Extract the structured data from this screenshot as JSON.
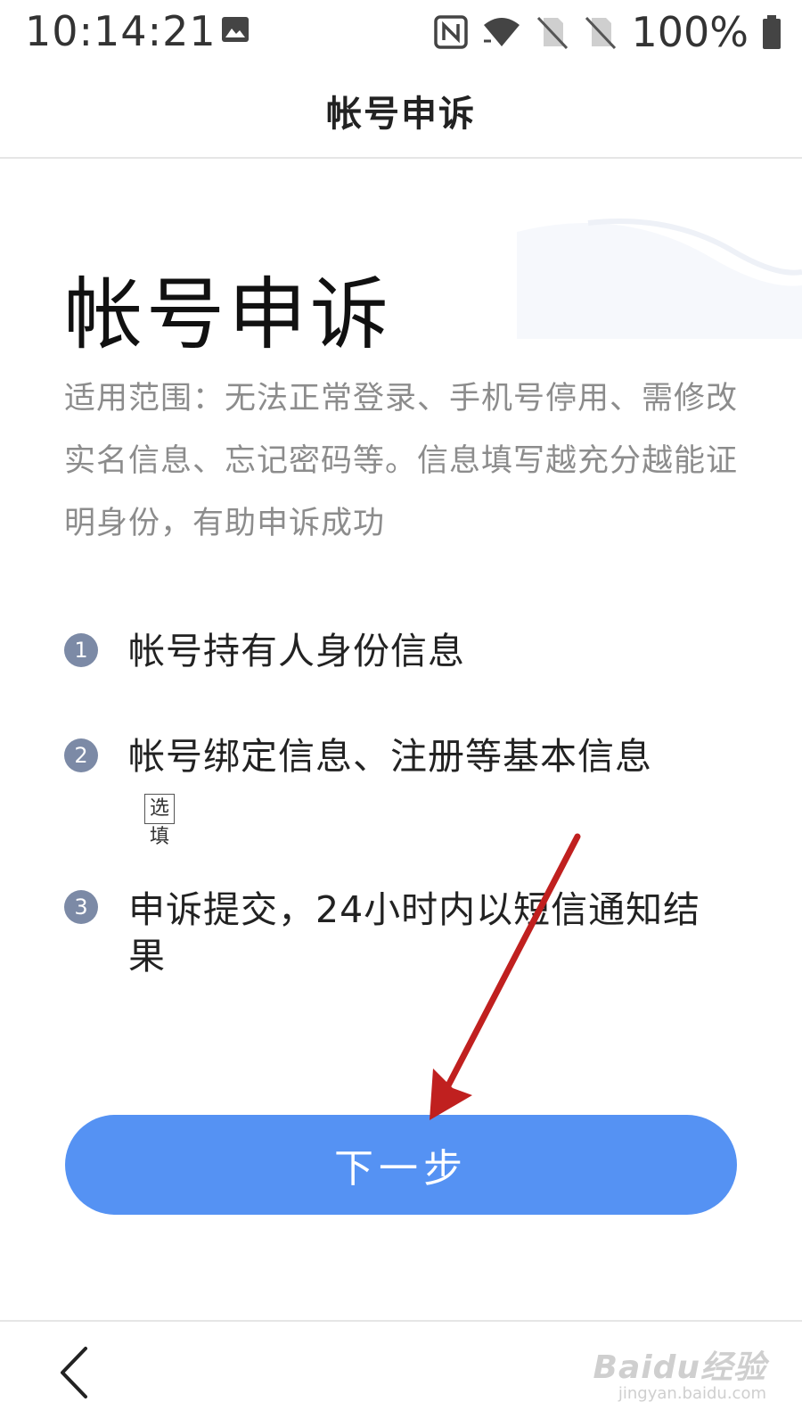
{
  "status_bar": {
    "time": "10:14:21",
    "battery_text": "100%",
    "icons": [
      "image-icon",
      "nfc-icon",
      "wifi-icon",
      "no-sim-icon",
      "no-sim-icon",
      "battery-icon"
    ]
  },
  "header": {
    "title": "帐号申诉"
  },
  "main": {
    "title": "帐号申诉",
    "description": "适用范围：无法正常登录、手机号停用、需修改实名信息、忘记密码等。信息填写越充分越能证明身份，有助申诉成功",
    "steps": [
      {
        "number": "1",
        "text": "帐号持有人身份信息"
      },
      {
        "number": "2",
        "text": "帐号绑定信息、注册等基本信息",
        "tag": "选填"
      },
      {
        "number": "3",
        "text": "申诉提交，24小时内以短信通知结果"
      }
    ],
    "next_button_label": "下一步"
  },
  "bottom_bar": {
    "watermark_logo": "Baidu经验",
    "watermark_url": "jingyan.baidu.com"
  },
  "colors": {
    "button": "#5592f3",
    "step_badge": "#7c8aa6",
    "description_text": "#8c8c8c",
    "annotation_arrow": "#c0201f"
  }
}
